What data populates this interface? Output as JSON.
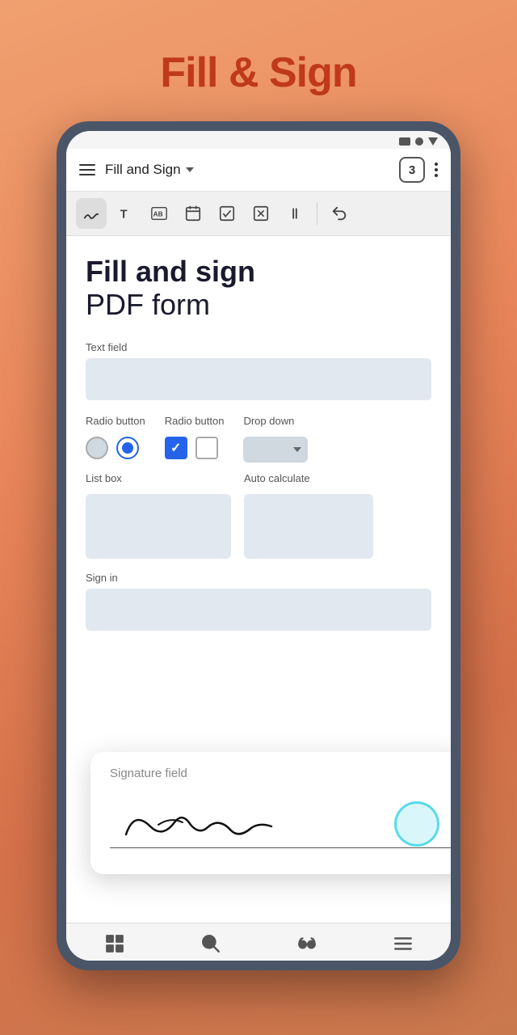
{
  "page": {
    "title": "Fill & Sign",
    "background_color": "#e8855a"
  },
  "status_bar": {
    "icons": [
      "rectangle",
      "circle",
      "triangle"
    ]
  },
  "app_bar": {
    "menu_label": "Menu",
    "title": "Fill and Sign",
    "badge_number": "3",
    "more_label": "More options"
  },
  "toolbar": {
    "tools": [
      {
        "id": "signature",
        "label": "Signature tool",
        "active": true
      },
      {
        "id": "text",
        "label": "Text tool",
        "active": false
      },
      {
        "id": "initials",
        "label": "Initials tool",
        "active": false
      },
      {
        "id": "date",
        "label": "Date tool",
        "active": false
      },
      {
        "id": "checkmark",
        "label": "Checkmark tool",
        "active": false
      },
      {
        "id": "cross",
        "label": "Cross tool",
        "active": false
      },
      {
        "id": "bracket",
        "label": "Bracket tool",
        "active": false
      },
      {
        "id": "undo",
        "label": "Undo",
        "active": false
      }
    ]
  },
  "document": {
    "title_bold": "Fill and sign",
    "title_normal": "PDF form",
    "text_field_label": "Text field",
    "text_field_placeholder": "",
    "radio_group1_label": "Radio button",
    "radio_group2_label": "Radio button",
    "dropdown_label": "Drop down",
    "list_box_label": "List box",
    "auto_calculate_label": "Auto calculate",
    "sign_in_label": "Sign in"
  },
  "signature_card": {
    "label": "Signature field"
  },
  "bottom_nav": {
    "items": [
      {
        "id": "grid",
        "label": "Grid view"
      },
      {
        "id": "search",
        "label": "Search"
      },
      {
        "id": "read",
        "label": "Read mode"
      },
      {
        "id": "menu",
        "label": "Menu"
      }
    ]
  }
}
